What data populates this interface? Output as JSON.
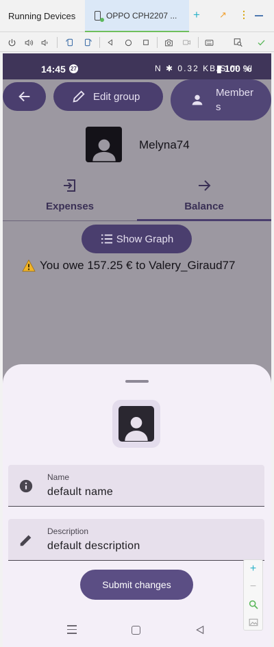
{
  "ide": {
    "panel_title": "Running Devices",
    "device_tab_label": "OPPO CPH2207 ...",
    "new_tab_label": "+"
  },
  "status_bar": {
    "time": "14:45",
    "notification_count": "27",
    "icons": "N ✱ 0.32 KB/S ◠ .ıl",
    "battery": "100 %"
  },
  "app_bar": {
    "edit_group_label": "Edit group",
    "members_label": "Members"
  },
  "group": {
    "name": "Melyna74"
  },
  "tabs": [
    {
      "label": "Expenses",
      "selected": false
    },
    {
      "label": "Balance",
      "selected": true
    }
  ],
  "balance": {
    "show_graph_label": "Show Graph",
    "owe_message": "You owe 157.25 € to Valery_Giraud77"
  },
  "sheet": {
    "name_label": "Name",
    "name_value": "default name",
    "description_label": "Description",
    "description_value": "default description",
    "submit_label": "Submit changes"
  },
  "zoom": {
    "in": "+",
    "out": "−"
  },
  "colors": {
    "primary": "#4a3e6e",
    "status_bar": "#3f3559",
    "sheet_bg": "#f4eff8",
    "warning": "#f0b429",
    "accent_green": "#6fbf5b"
  }
}
